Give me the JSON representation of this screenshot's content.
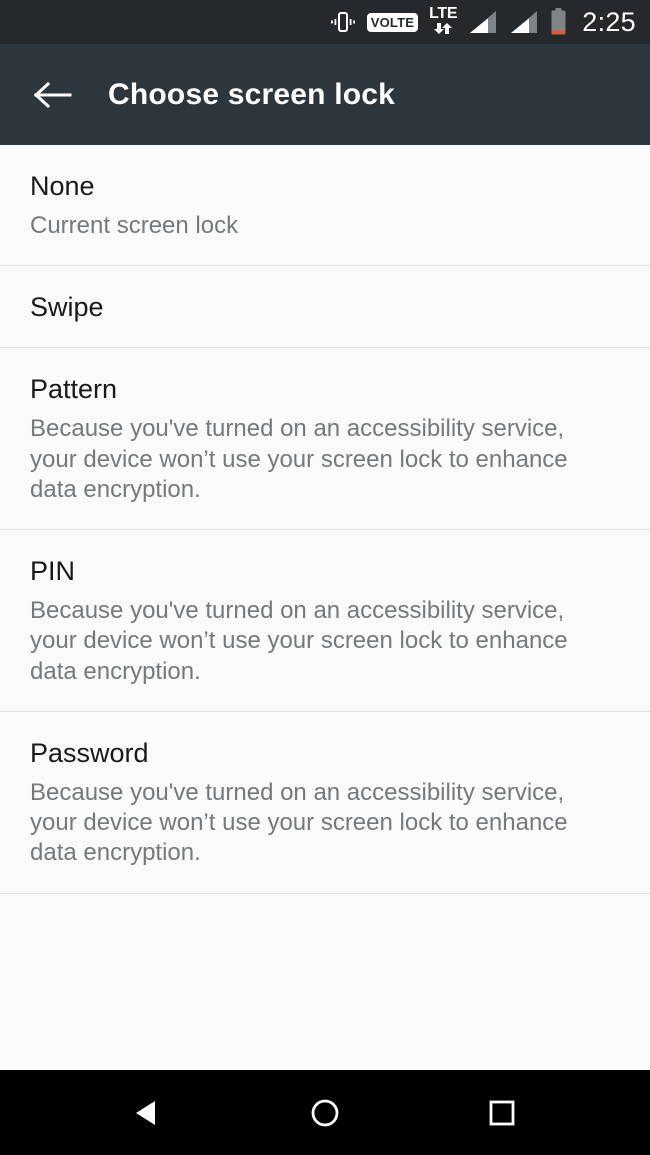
{
  "status_bar": {
    "vibrate_icon": "vibrate-icon",
    "volte_label": "VOLTE",
    "network_type": "LTE",
    "data_arrows_icon": "data-transfer-icon",
    "signal_1_icon": "signal-bars-icon",
    "signal_2_icon": "signal-bars-icon",
    "battery_icon": "battery-low-icon",
    "time": "2:25"
  },
  "app_bar": {
    "back_icon": "back-arrow-icon",
    "title": "Choose screen lock"
  },
  "lock_options": [
    {
      "title": "None",
      "desc": "Current screen lock"
    },
    {
      "title": "Swipe",
      "desc": ""
    },
    {
      "title": "Pattern",
      "desc": "Because you've turned on an accessibility service, your device won’t use your screen lock to enhance data encryption."
    },
    {
      "title": "PIN",
      "desc": "Because you've turned on an accessibility service, your device won’t use your screen lock to enhance data encryption."
    },
    {
      "title": "Password",
      "desc": "Because you've turned on an accessibility service, your device won’t use your screen lock to enhance data encryption."
    }
  ],
  "nav_bar": {
    "back_icon": "nav-back-triangle-icon",
    "home_icon": "nav-home-circle-icon",
    "recents_icon": "nav-recents-square-icon"
  },
  "colors": {
    "status_bar_bg": "#25292b",
    "app_bar_bg": "#2d363c",
    "content_bg": "#fafafa",
    "divider": "#e2e2e2",
    "title_text": "#1a1a1a",
    "desc_text": "#76797b",
    "nav_bar_bg": "#000000",
    "battery_warning": "#e8552d"
  }
}
